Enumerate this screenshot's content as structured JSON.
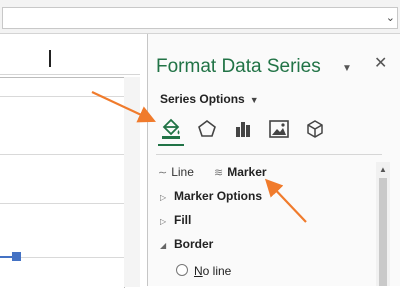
{
  "pane": {
    "title": "Format Data Series",
    "menu_icon": "triangle-down-icon",
    "close_icon": "close-x-icon",
    "series_options_label": "Series Options",
    "icons": [
      "fill-line-paint-bucket-icon",
      "effects-pentagon-icon",
      "series-options-bar-chart-icon",
      "picture-icon",
      "3d-format-cube-icon"
    ],
    "sub_tabs": [
      {
        "label": "Line",
        "icon": "line-glyph-icon"
      },
      {
        "label": "Marker",
        "icon": "marker-line-glyph-icon"
      }
    ],
    "sections": [
      {
        "label": "Marker Options",
        "expanded": false
      },
      {
        "label": "Fill",
        "expanded": false
      },
      {
        "label": "Border",
        "expanded": true
      }
    ],
    "border_options": [
      {
        "label_underlined": "N",
        "label_rest": "o line"
      }
    ]
  },
  "colors": {
    "title_green": "#217346",
    "series_blue": "#4472c4",
    "annotation_arrow": "#f07b2c"
  }
}
